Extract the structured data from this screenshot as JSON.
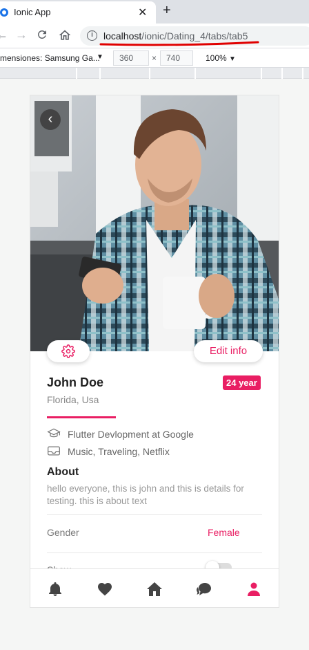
{
  "browser": {
    "tab_title": "Ionic App",
    "tab_close": "✕",
    "new_tab": "+",
    "url_host": "localhost",
    "url_path": "/ionic/Dating_4/tabs/tab5",
    "info_icon": "i"
  },
  "devtools": {
    "device_label": "mensiones: Samsung Ga...",
    "width": "360",
    "height": "740",
    "times": "×",
    "zoom": "100%"
  },
  "profile": {
    "back_icon": "‹",
    "edit_label": "Edit info",
    "name": "John Doe",
    "age": "24 year",
    "location": "Florida, Usa",
    "work": "Flutter Devlopment at Google",
    "hobbies": "Music, Traveling, Netflix",
    "about_title": "About",
    "about_text": "hello everyone, this is john and this is details for testing. this is about text",
    "gender_label": "Gender",
    "gender_value": "Female",
    "show_label": "Show"
  },
  "tabs": [
    {
      "icon": "bell-icon"
    },
    {
      "icon": "heart-icon"
    },
    {
      "icon": "home-icon"
    },
    {
      "icon": "chat-icon"
    },
    {
      "icon": "person-icon",
      "active": true
    }
  ],
  "colors": {
    "accent": "#e91e63",
    "tab_inactive": "#444444"
  }
}
